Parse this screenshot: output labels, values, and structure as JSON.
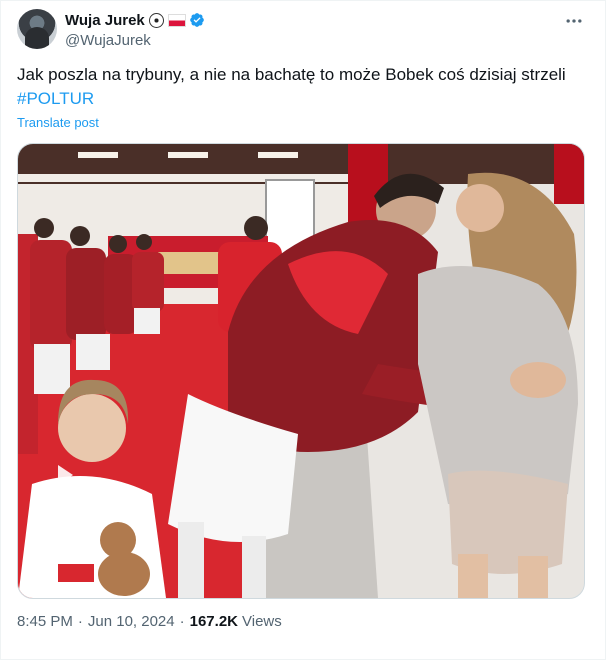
{
  "author": {
    "display_name": "Wuja Jurek",
    "emojis": [
      "soccer-ball",
      "poland-flag"
    ],
    "verified": true,
    "handle": "@WujaJurek",
    "verified_color": "#1d9bf0"
  },
  "more_icon": "more-horizontal-icon",
  "post": {
    "text": "Jak poszla na trybuny, a nie na bachatę to może Bobek coś dzisiaj strzeli",
    "hashtag": "#POLTUR",
    "translate_label": "Translate post"
  },
  "media": {
    "type": "video",
    "play_icon": "play-icon"
  },
  "meta": {
    "time": "8:45 PM",
    "separator": "·",
    "date": "Jun 10, 2024",
    "separator2": "·",
    "views_count": "167.2K",
    "views_label": "Views"
  },
  "colors": {
    "link": "#1d9bf0",
    "text": "#0f1419",
    "secondary": "#536471",
    "border": "#cfd9de"
  }
}
